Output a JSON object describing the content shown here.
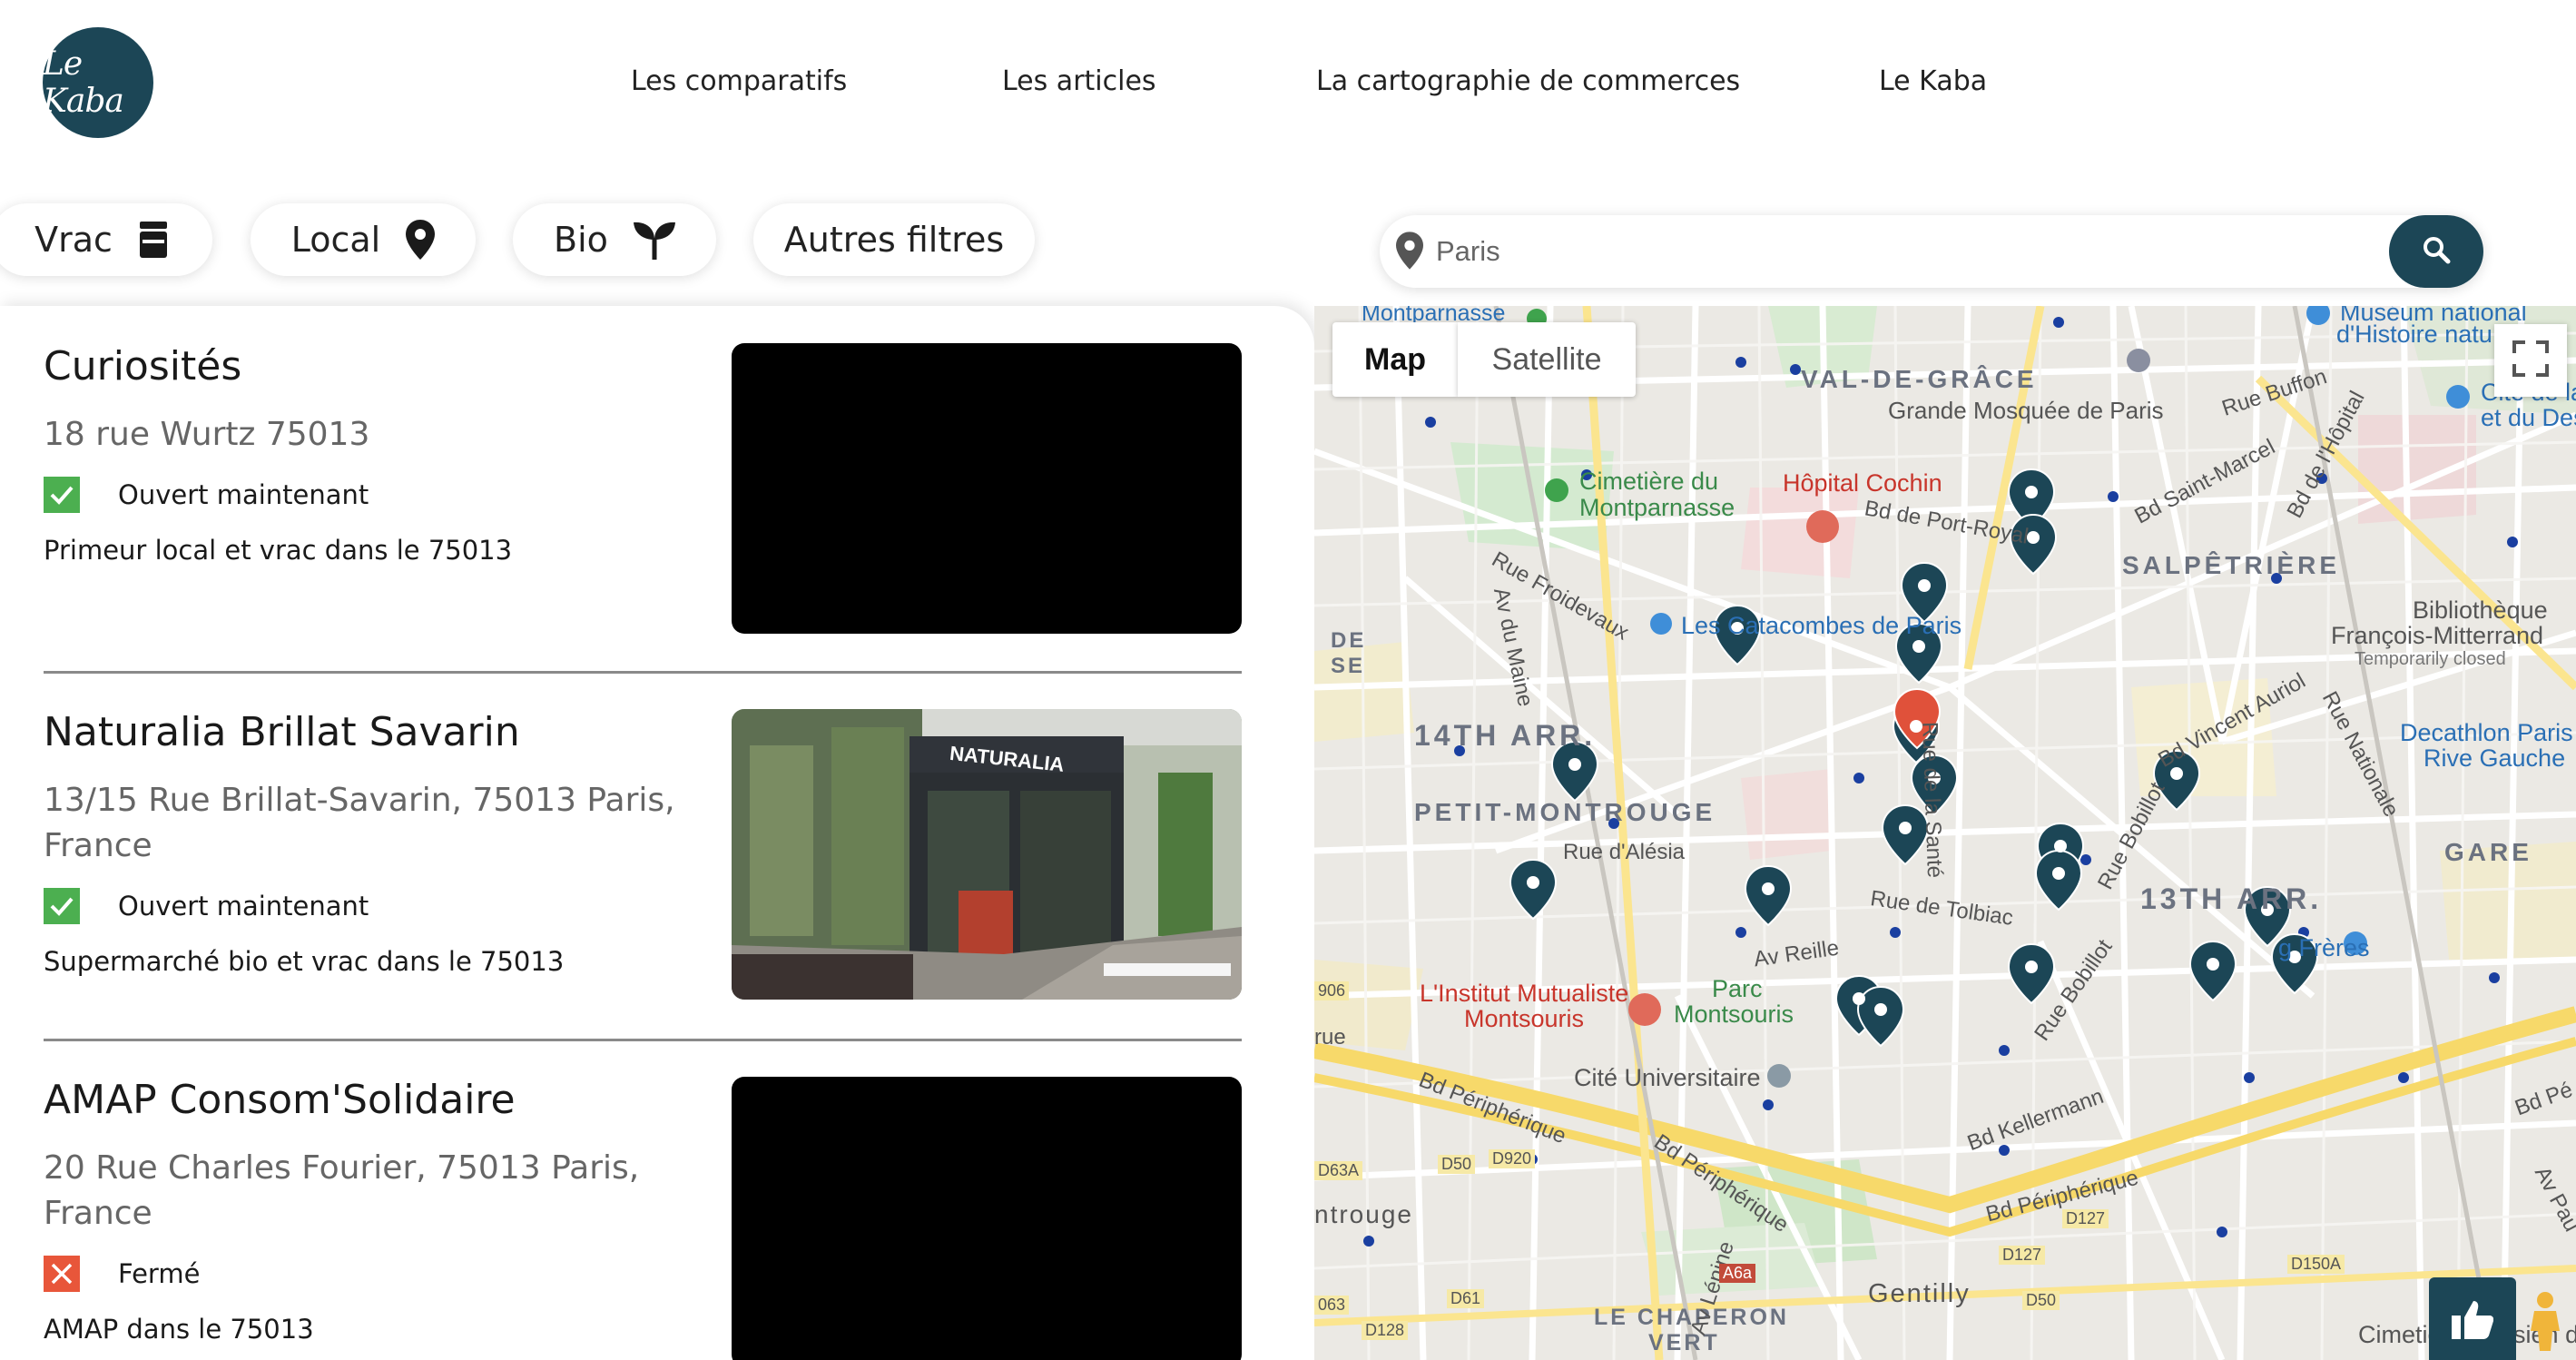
{
  "header": {
    "logo_text": "Le Kaba",
    "nav": [
      "Les comparatifs",
      "Les articles",
      "La cartographie de commerces",
      "Le Kaba"
    ]
  },
  "filters": {
    "vrac": "Vrac",
    "local": "Local",
    "bio": "Bio",
    "autres": "Autres filtres"
  },
  "search": {
    "placeholder": "Paris",
    "value": ""
  },
  "shops": [
    {
      "name": "Curiosités",
      "address": "18 rue Wurtz 75013",
      "status": "Ouvert maintenant",
      "status_open": true,
      "description": "Primeur local et vrac dans le 75013",
      "has_photo": false
    },
    {
      "name": "Naturalia Brillat Savarin",
      "address": "13/15 Rue Brillat-Savarin, 75013 Paris, France",
      "status": "Ouvert maintenant",
      "status_open": true,
      "description": "Supermarché bio et vrac dans le 75013",
      "has_photo": true,
      "photo_sign": "NATURALIA"
    },
    {
      "name": "AMAP Consom'Solidaire",
      "address": "20 Rue Charles Fourier, 75013 Paris, France",
      "status": "Fermé",
      "status_open": false,
      "description": "AMAP dans le 75013",
      "has_photo": false
    }
  ],
  "map": {
    "type_buttons": [
      "Map",
      "Satellite"
    ],
    "selected_type": "Map",
    "labels": {
      "val_de_grace": "VAL-DE-GRÂCE",
      "grande_mosquee": "Grande Mosquée de Paris",
      "salpetriere": "SALPÊTRIÈRE",
      "arr14": "14TH ARR.",
      "arr13": "13TH ARR.",
      "petit_montrouge": "PETIT-MONTROUGE",
      "gare": "GARE",
      "le_chaperon_vert": "LE CHAPERON",
      "vert": "VERT",
      "gentilly": "Gentilly",
      "montrouge": "ntrouge",
      "cimetiere_montparnasse_1": "Cimetière du",
      "cimetiere_montparnasse_2": "Montparnasse",
      "hopital_cochin": "Hôpital Cochin",
      "catacombes": "Les Catacombes de Paris",
      "institut_1": "L'Institut Mutualiste",
      "institut_2": "Montsouris",
      "parc_1": "Parc",
      "parc_2": "Montsouris",
      "cite_univ": "Cité Universitaire",
      "bibliotheque_1": "Bibliothèque",
      "bibliotheque_2": "François-Mitterrand",
      "bibliotheque_3": "Temporarily closed",
      "decathlon_1": "Decathlon Paris",
      "decathlon_2": "Rive Gauche",
      "museum_1": "Muséum national",
      "museum_2": "d'Histoire natu",
      "cite_eau_1": "Cité de la",
      "cite_eau_2": "et du Des",
      "tang": "g Frères",
      "montparnasse": "Montparnasse",
      "cimetiere_ivry": "Cimetière Parisien d'Iv",
      "rue_froidevaux": "Rue Froidevaux",
      "av_du_maine": "Av du Maine",
      "rue_alesia": "Rue d'Alésia",
      "rue_sante": "Rue de la Santé",
      "rue_tolbiac": "Rue de Tolbiac",
      "av_reille": "Av Reille",
      "bd_port_royal": "Bd de Port-Royal",
      "bd_saint_marcel": "Bd Saint-Marcel",
      "bd_hopital": "Bd de l'Hôpital",
      "rue_buffon": "Rue Buffon",
      "bd_vincent_auriol": "Bd Vincent Auriol",
      "rue_nationale": "Rue Nationale",
      "rue_bobillot": "Rue Bobillot",
      "bd_kellermann": "Bd Kellermann",
      "bd_peripherique": "Bd Périphérique",
      "av_lenine": "Av Lénine",
      "av_paul": "Av Pau",
      "rue_edge": "rue",
      "d906": "906",
      "d63a": "D63A",
      "d50": "D50",
      "d920": "D920",
      "d127": "D127",
      "d127b": "D127",
      "d150a": "D150A",
      "d61": "D61",
      "a6a": "A6a",
      "d50b": "D50",
      "d128": "D128",
      "n063": "063",
      "e_left": "DE",
      "e_left2": "SE",
      "bd_per_right": "Bd Pé"
    }
  },
  "colors": {
    "brand": "#1c4656",
    "open": "#4caf50",
    "closed": "#e8563a",
    "selected_marker": "#e0513a"
  },
  "icons": {
    "vrac": "jar-icon",
    "local": "location-pin-icon",
    "bio": "sprout-icon",
    "search": "magnifier-icon",
    "like": "thumbs-up-icon",
    "fullscreen": "fullscreen-icon",
    "pegman": "street-view-pegman-icon"
  }
}
